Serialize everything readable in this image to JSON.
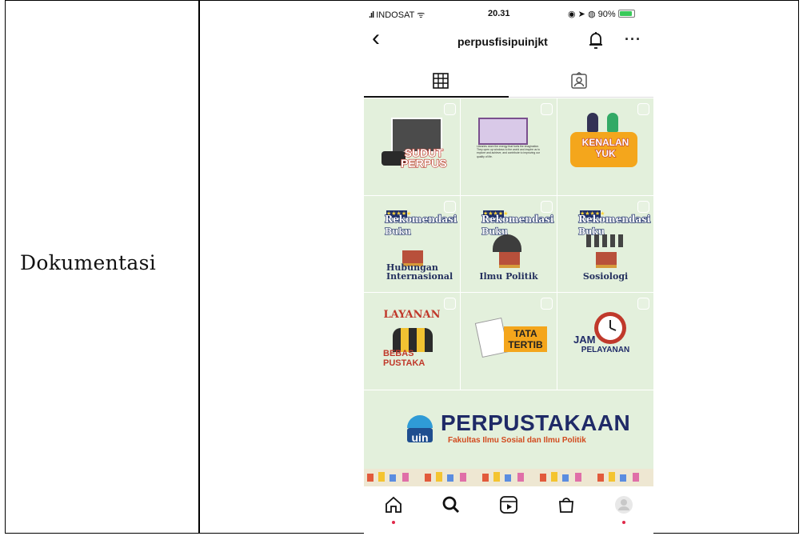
{
  "document": {
    "row_label": "Dokumentasi"
  },
  "status_bar": {
    "carrier": "INDOSAT",
    "time": "20.31",
    "battery": "90%"
  },
  "header": {
    "username": "perpusfisipuinjkt"
  },
  "posts": [
    {
      "lines": [
        "SUDUT",
        "PERPUS"
      ]
    },
    {
      "quote": "Libraries store the energy that fuels the imagination. They open up windows to the world and inspire us to explore and achieve, and contribute to improving our quality of life."
    },
    {
      "lines": [
        "KENALAN",
        "YUK"
      ]
    },
    {
      "heading": [
        "Rekomendasi",
        "Buku"
      ],
      "subject": [
        "Hubungan",
        "Internasional"
      ]
    },
    {
      "heading": [
        "Rekomendasi",
        "Buku"
      ],
      "subject": [
        "Ilmu Politik"
      ]
    },
    {
      "heading": [
        "Rekomendasi",
        "Buku"
      ],
      "subject": [
        "Sosiologi"
      ]
    },
    {
      "lines": [
        "LAYANAN",
        "BEBAS",
        "PUSTAKA"
      ]
    },
    {
      "lines": [
        "TATA",
        "TERTIB"
      ]
    },
    {
      "lines": [
        "JAM",
        "PELAYANAN"
      ]
    }
  ],
  "banner": {
    "logo_text": "uin",
    "title": "PERPUSTAKAAN",
    "subtitle": "Fakultas Ilmu Sosial dan Ilmu Politik"
  },
  "colors": {
    "post_bg": "#e3f0dc",
    "brand_navy": "#1f2a67",
    "brand_orange": "#d24a1e",
    "notif_dot": "#e0294a"
  },
  "icons": {
    "header": [
      "back-icon",
      "bell-icon",
      "more-icon"
    ],
    "tabs": [
      "grid-icon",
      "tagged-icon"
    ],
    "nav": [
      "home-icon",
      "search-icon",
      "reels-icon",
      "shop-icon",
      "profile-icon"
    ]
  }
}
